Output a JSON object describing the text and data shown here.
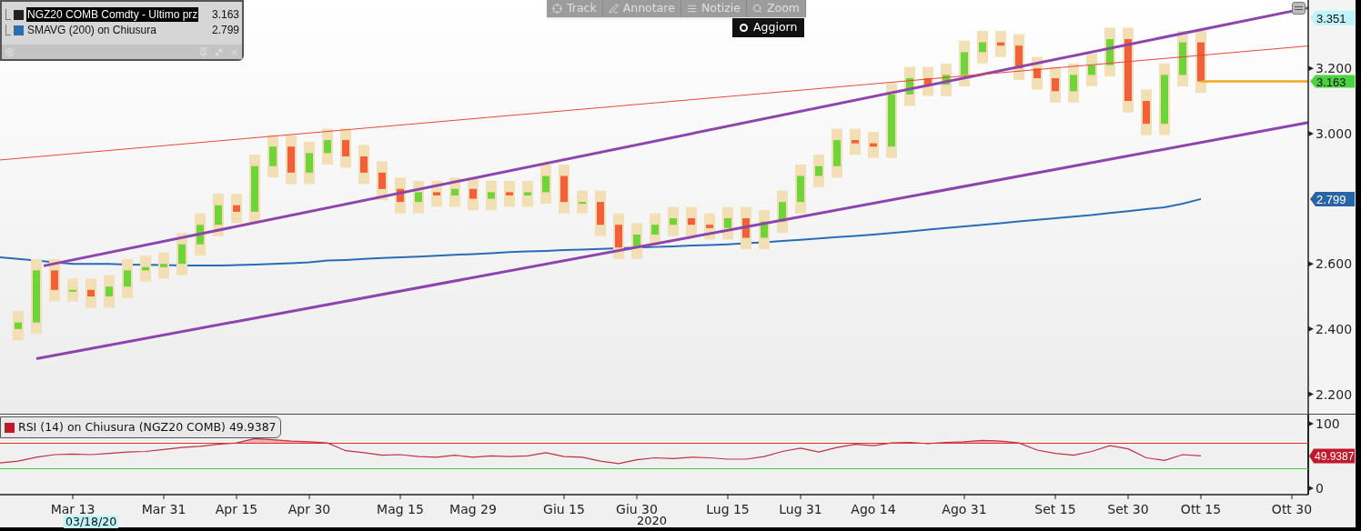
{
  "legend": {
    "rows": [
      {
        "label": "NGZ20 COMB Comdty - Ultimo prz",
        "value": "3.163",
        "color": "#222222",
        "selected": true
      },
      {
        "label": "SMAVG (200)  on Chiusura",
        "value": "2.799",
        "color": "#2a6db5",
        "selected": false
      }
    ]
  },
  "toolbar": {
    "buttons": [
      {
        "label": "Track",
        "kind": "track"
      },
      {
        "label": "Annotare",
        "kind": "annotate"
      },
      {
        "label": "Notizie",
        "kind": "news"
      },
      {
        "label": "Zoom",
        "kind": "zoom"
      }
    ],
    "menu_item": "Aggiorn"
  },
  "price_chart": {
    "axis_labels": [
      "3.200",
      "3.000",
      "2.600",
      "2.400",
      "2.200"
    ],
    "price_tags": [
      {
        "text": "3.351",
        "kind": "high",
        "color": "#bff3f5"
      },
      {
        "text": "3.163",
        "kind": "last",
        "color": "#4cd440"
      },
      {
        "text": "2.799",
        "kind": "sma",
        "color": "#2a64a8"
      }
    ]
  },
  "rsi_panel": {
    "legend": {
      "value": "49.9387",
      "color": "#c0182c"
    },
    "tag": {
      "text": "49.9387",
      "color": "#c0182c"
    },
    "chart_data": {
      "type": "line",
      "categories": [
        null,
        null,
        null,
        null,
        "Mar 13",
        null,
        null,
        null,
        null,
        "Mar 31",
        null,
        null,
        null,
        "Apr 15",
        null,
        null,
        null,
        "Apr 30",
        null,
        null,
        null,
        null,
        "Mag 15",
        null,
        null,
        null,
        "Mag 29",
        null,
        null,
        null,
        null,
        "Giu 15",
        null,
        null,
        null,
        "Giu 30",
        null,
        null,
        null,
        null,
        "Lug 15",
        null,
        null,
        null,
        "Lug 31",
        null,
        null,
        null,
        "Ago 14",
        null,
        null,
        null,
        null,
        "Ago 31",
        null,
        null,
        null,
        null,
        "Set 15",
        null,
        null,
        null,
        "Set 30",
        null,
        null,
        null,
        "Ott 15",
        null,
        null,
        null,
        null,
        "Ott 30"
      ],
      "series": [
        {
          "name": "RSI (14)  on Chiusura (NGZ20 COMB)",
          "color": "#c0304a",
          "values": [
            39,
            42,
            48,
            52,
            53,
            52,
            54,
            56,
            57,
            60,
            63,
            65,
            68,
            70,
            77,
            75,
            73,
            72,
            70,
            58,
            55,
            51,
            52,
            49,
            48,
            51,
            48,
            50,
            49,
            50,
            55,
            49,
            48,
            42,
            38,
            44,
            47,
            46,
            48,
            47,
            45,
            45,
            49,
            57,
            62,
            56,
            63,
            68,
            66,
            70,
            71,
            69,
            71,
            72,
            74,
            73,
            70,
            59,
            54,
            51,
            57,
            66,
            61,
            47,
            43,
            52,
            50,
            null,
            null,
            null,
            null,
            null
          ]
        }
      ],
      "ylim": [
        -10,
        114
      ],
      "yticks": [
        100,
        0
      ]
    }
  },
  "x_axis": {
    "cursor_date": "03/18/20",
    "year": "2020"
  }
}
